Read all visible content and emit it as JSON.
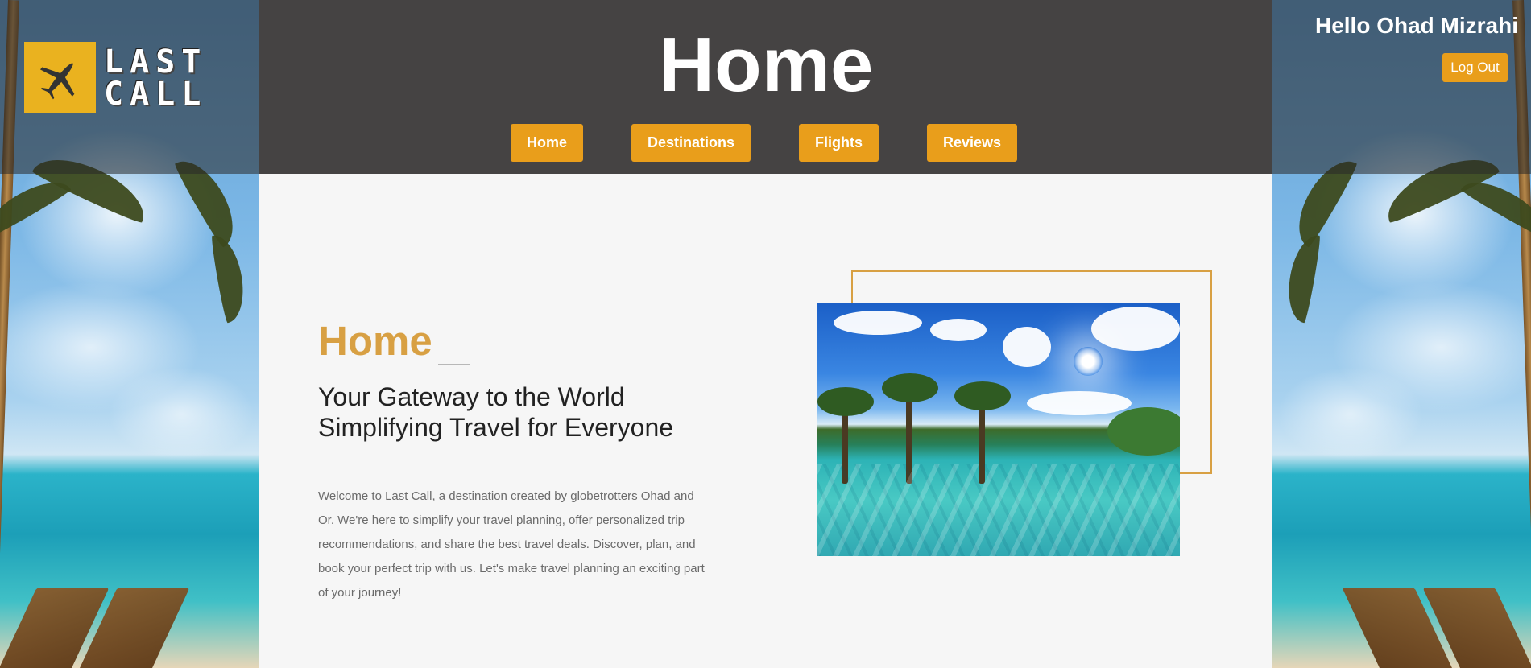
{
  "brand": {
    "logo_line1": "LAST",
    "logo_line2": "CALL"
  },
  "header": {
    "page_title": "Home",
    "greeting": "Hello Ohad Mizrahi",
    "logout_label": "Log Out"
  },
  "nav": [
    {
      "label": "Home"
    },
    {
      "label": "Destinations"
    },
    {
      "label": "Flights"
    },
    {
      "label": "Reviews"
    }
  ],
  "main": {
    "section_title": "Home",
    "tagline_line1": "Your Gateway to the World",
    "tagline_line2": "Simplifying Travel for Everyone",
    "intro": "Welcome to Last Call, a destination created by globetrotters Ohad and Or. We're here to simplify your travel planning, offer personalized trip recommendations, and share the best travel deals. Discover, plan, and book your perfect trip with us. Let's make travel planning an exciting part of your journey!"
  },
  "colors": {
    "accent": "#e99e1b",
    "title_gold": "#d8a043",
    "header_bg": "#454343",
    "logo_yellow": "#eab21f"
  },
  "icons": {
    "logo": "airplane-icon"
  }
}
